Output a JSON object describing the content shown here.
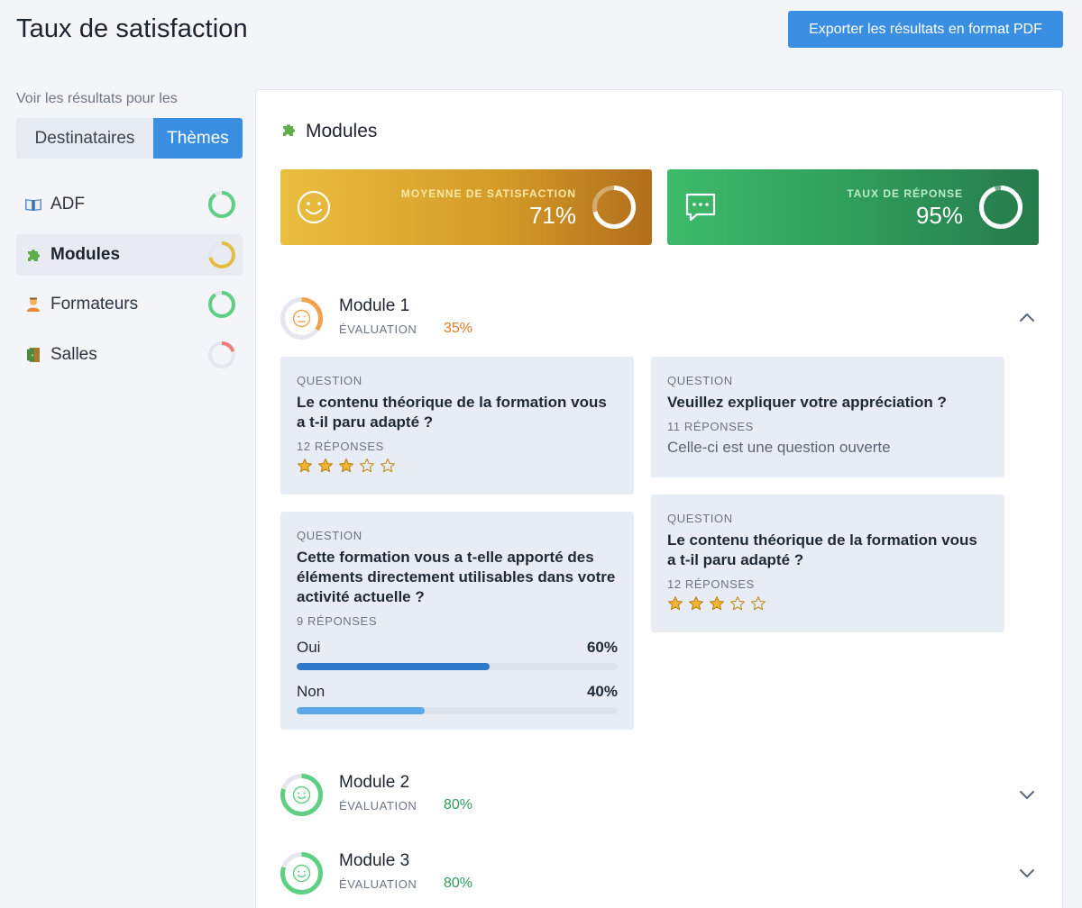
{
  "header": {
    "title": "Taux de satisfaction",
    "export_label": "Exporter les résultats en format PDF"
  },
  "sidebar": {
    "voir_label": "Voir les résultats pour les",
    "toggle": {
      "option_1": "Destinataires",
      "option_2": "Thèmes",
      "selected": "Thèmes"
    },
    "items": [
      {
        "label": "ADF",
        "icon": "open-book-icon",
        "level": 0.9,
        "color": "#5fcf84"
      },
      {
        "label": "Modules",
        "icon": "puzzle-piece-icon",
        "level": 0.71,
        "color": "#e5bd43",
        "active": true
      },
      {
        "label": "Formateurs",
        "icon": "teacher-icon",
        "level": 0.9,
        "color": "#5fcf84"
      },
      {
        "label": "Salles",
        "icon": "door-icon",
        "level": 0.2,
        "color": "#ef7b7b"
      }
    ]
  },
  "main": {
    "title": "Modules",
    "kpis": {
      "satisfaction": {
        "label": "MOYENNE DE SATISFACTION",
        "value": "71%",
        "level": 0.71
      },
      "response": {
        "label": "TAUX DE RÉPONSE",
        "value": "95%",
        "level": 0.95
      }
    },
    "modules": [
      {
        "name": "Module 1",
        "eval_label": "ÉVALUATION",
        "eval_value": "35%",
        "level": 0.35,
        "color": "#f0a24c",
        "value_color": "#e07b22",
        "expanded": true
      },
      {
        "name": "Module 2",
        "eval_label": "ÉVALUATION",
        "eval_value": "80%",
        "level": 0.8,
        "color": "#5fcf84",
        "value_color": "#2f9a5a",
        "expanded": false
      },
      {
        "name": "Module 3",
        "eval_label": "ÉVALUATION",
        "eval_value": "80%",
        "level": 0.8,
        "color": "#5fcf84",
        "value_color": "#2f9a5a",
        "expanded": false
      }
    ],
    "questions": {
      "q1": {
        "label": "QUESTION",
        "text": "Le contenu théorique de la formation vous a t-il paru adapté ?",
        "count": "12 RÉPONSES",
        "stars": 3,
        "stars_max": 5
      },
      "q2": {
        "label": "QUESTION",
        "text": "Veuillez expliquer votre appréciation ?",
        "count": "11 RÉPONSES",
        "open_text": "Celle-ci est une question ouverte"
      },
      "q3": {
        "label": "QUESTION",
        "text": "Cette formation vous a t-elle apporté des éléments directement utilisables dans votre activité actuelle ?",
        "count": "9 RÉPONSES",
        "options": [
          {
            "label": "Oui",
            "pct": "60%",
            "value": 0.6,
            "color": "#2f78c9"
          },
          {
            "label": "Non",
            "pct": "40%",
            "value": 0.4,
            "color": "#5aa8e8"
          }
        ]
      },
      "q4": {
        "label": "QUESTION",
        "text": "Le contenu théorique de la formation vous a t-il paru adapté ?",
        "count": "12 RÉPONSES",
        "stars": 3,
        "stars_max": 5
      }
    }
  }
}
